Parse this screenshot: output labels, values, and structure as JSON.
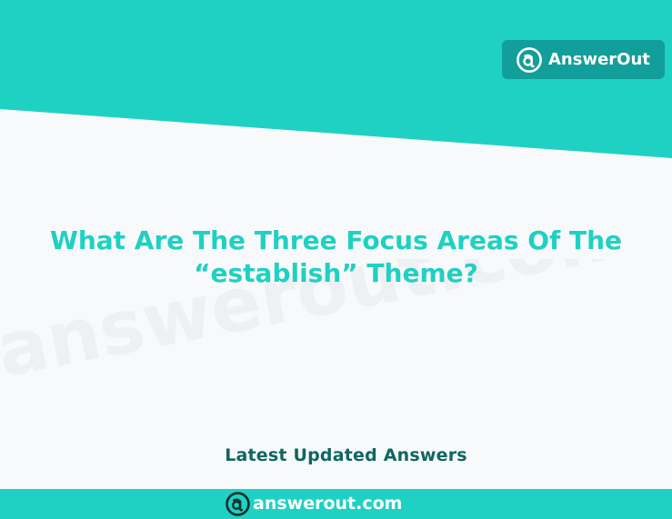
{
  "brand": {
    "name": "AnswerOut",
    "domain": "answerout.com",
    "logo_icon": "answerout-logo-icon"
  },
  "watermark": {
    "text": "answerout.com"
  },
  "question": {
    "title": "What Are The Three Focus Areas Of The “establish” Theme?"
  },
  "section": {
    "latest_heading": "Latest Updated Answers"
  },
  "colors": {
    "accent": "#1fd1c2",
    "badge": "#129e9a",
    "heading_dark": "#0f6663",
    "background": "#f8f9fb"
  }
}
